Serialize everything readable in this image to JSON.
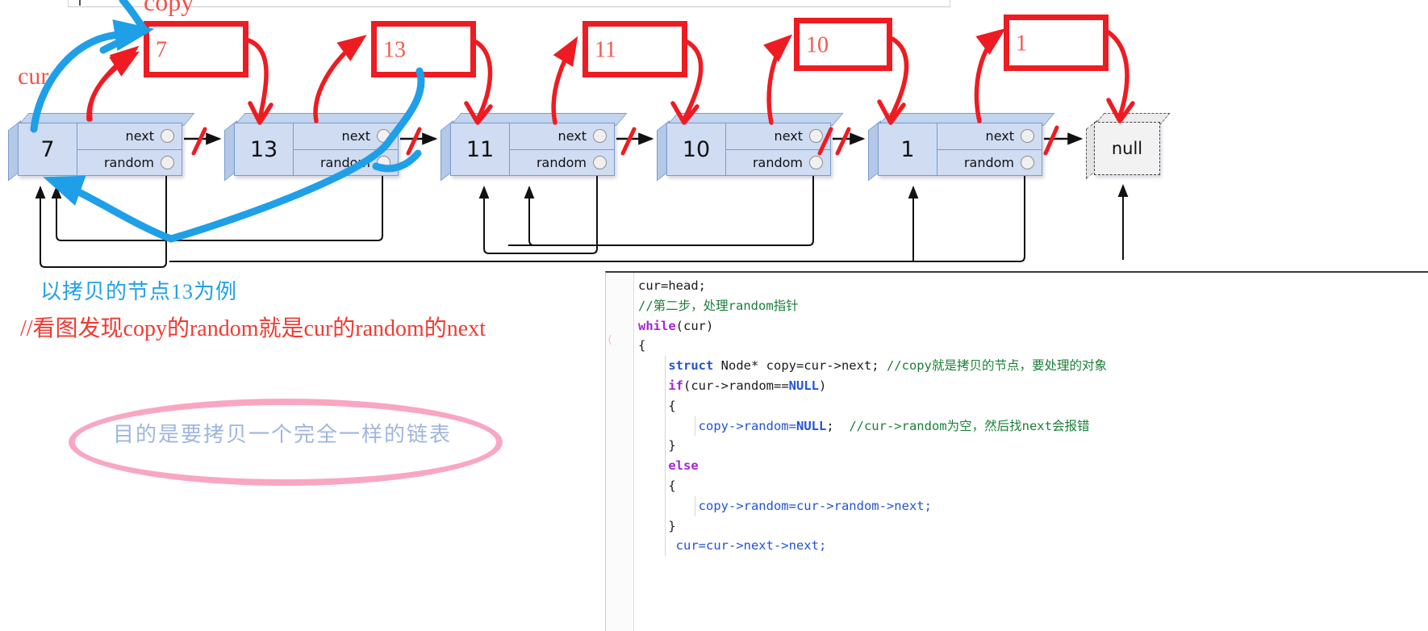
{
  "diagram": {
    "title_annotations": {
      "cur_label": "cur",
      "copy_label": "copy"
    },
    "nodes": [
      {
        "value": "7",
        "next_label": "next",
        "random_label": "random"
      },
      {
        "value": "13",
        "next_label": "next",
        "random_label": "random"
      },
      {
        "value": "11",
        "next_label": "next",
        "random_label": "random"
      },
      {
        "value": "10",
        "next_label": "next",
        "random_label": "random"
      },
      {
        "value": "1",
        "next_label": "next",
        "random_label": "random"
      }
    ],
    "terminator": "null",
    "copy_boxes": [
      {
        "value": "7"
      },
      {
        "value": "13"
      },
      {
        "value": "11"
      },
      {
        "value": "10"
      },
      {
        "value": "1"
      }
    ]
  },
  "notes": {
    "blue_note": "以拷贝的节点13为例",
    "red_note": "//看图发现copy的random就是cur的random的next",
    "oval_note": "目的是要拷贝一个完全一样的链表"
  },
  "code": {
    "lines": [
      {
        "indent": 0,
        "parts": [
          {
            "t": "cur=head;",
            "c": "pun"
          }
        ]
      },
      {
        "indent": 0,
        "parts": [
          {
            "t": "//第二步，处理random指针",
            "c": "cmt"
          }
        ]
      },
      {
        "indent": 0,
        "parts": [
          {
            "t": "while",
            "c": "kw"
          },
          {
            "t": "(cur)",
            "c": "pun"
          }
        ]
      },
      {
        "indent": 0,
        "parts": [
          {
            "t": "{",
            "c": "pun"
          }
        ]
      },
      {
        "indent": 1,
        "parts": [
          {
            "t": "struct",
            "c": "typ"
          },
          {
            "t": " Node* copy=cur->next; ",
            "c": "pun"
          },
          {
            "t": "//copy就是拷贝的节点，要处理的对象",
            "c": "cmt"
          }
        ]
      },
      {
        "indent": 1,
        "parts": [
          {
            "t": "if",
            "c": "kw"
          },
          {
            "t": "(cur->random==",
            "c": "pun"
          },
          {
            "t": "NULL",
            "c": "nul"
          },
          {
            "t": ")",
            "c": "pun"
          }
        ]
      },
      {
        "indent": 1,
        "parts": [
          {
            "t": "{",
            "c": "pun"
          }
        ]
      },
      {
        "indent": 2,
        "parts": [
          {
            "t": "copy->random=",
            "c": "blu"
          },
          {
            "t": "NULL",
            "c": "nul"
          },
          {
            "t": ";  ",
            "c": "pun"
          },
          {
            "t": "//cur->random为空，然后找next会报错",
            "c": "cmt"
          }
        ]
      },
      {
        "indent": 1,
        "parts": [
          {
            "t": "}",
            "c": "pun"
          }
        ]
      },
      {
        "indent": 1,
        "parts": [
          {
            "t": "else",
            "c": "kw"
          }
        ]
      },
      {
        "indent": 1,
        "parts": [
          {
            "t": "{",
            "c": "pun"
          }
        ]
      },
      {
        "indent": 2,
        "parts": [
          {
            "t": "copy->random=cur->random->next;",
            "c": "blu"
          }
        ]
      },
      {
        "indent": 1,
        "parts": [
          {
            "t": "}",
            "c": "pun"
          }
        ]
      },
      {
        "indent": 1,
        "parts": [
          {
            "t": " cur=cur->next->next;",
            "c": "blu"
          }
        ]
      }
    ]
  },
  "colors": {
    "node_fill": "#cfdcf2",
    "node_border": "#7a9ccd",
    "annotation_red": "#ee1c22",
    "annotation_blue": "#22a0e8",
    "oval_pink": "#f9a7c0",
    "comment_green": "#1a7f37",
    "keyword_purple": "#a626d6"
  }
}
